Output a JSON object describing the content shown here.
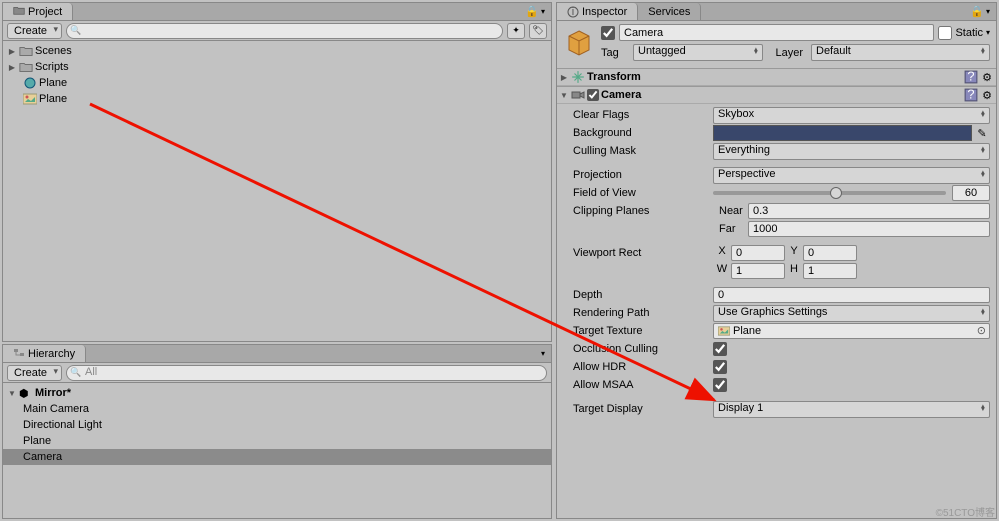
{
  "project": {
    "title": "Project",
    "create": "Create",
    "search_placeholder": "",
    "items": {
      "scenes": "Scenes",
      "scripts": "Scripts",
      "plane_asset": "Plane",
      "plane_tex": "Plane"
    }
  },
  "hierarchy": {
    "title": "Hierarchy",
    "create": "Create",
    "search_placeholder": "All",
    "scene": "Mirror*",
    "items": {
      "main_camera": "Main Camera",
      "dir_light": "Directional Light",
      "plane": "Plane",
      "camera": "Camera"
    }
  },
  "inspector": {
    "title": "Inspector",
    "services": "Services",
    "obj_name": "Camera",
    "static": "Static",
    "tag_label": "Tag",
    "tag_value": "Untagged",
    "layer_label": "Layer",
    "layer_value": "Default",
    "transform_title": "Transform",
    "camera_title": "Camera",
    "clear_flags": {
      "label": "Clear Flags",
      "value": "Skybox"
    },
    "background": {
      "label": "Background"
    },
    "culling_mask": {
      "label": "Culling Mask",
      "value": "Everything"
    },
    "projection": {
      "label": "Projection",
      "value": "Perspective"
    },
    "fov": {
      "label": "Field of View",
      "value": "60"
    },
    "clipping": {
      "label": "Clipping Planes",
      "near_label": "Near",
      "near": "0.3",
      "far_label": "Far",
      "far": "1000"
    },
    "viewport": {
      "label": "Viewport Rect",
      "x": "0",
      "y": "0",
      "w": "1",
      "h": "1"
    },
    "depth": {
      "label": "Depth",
      "value": "0"
    },
    "rendering_path": {
      "label": "Rendering Path",
      "value": "Use Graphics Settings"
    },
    "target_texture": {
      "label": "Target Texture",
      "value": "Plane"
    },
    "occlusion": {
      "label": "Occlusion Culling"
    },
    "allow_hdr": {
      "label": "Allow HDR"
    },
    "allow_msaa": {
      "label": "Allow MSAA"
    },
    "target_display": {
      "label": "Target Display",
      "value": "Display 1"
    }
  },
  "watermark": "©51CTO博客"
}
